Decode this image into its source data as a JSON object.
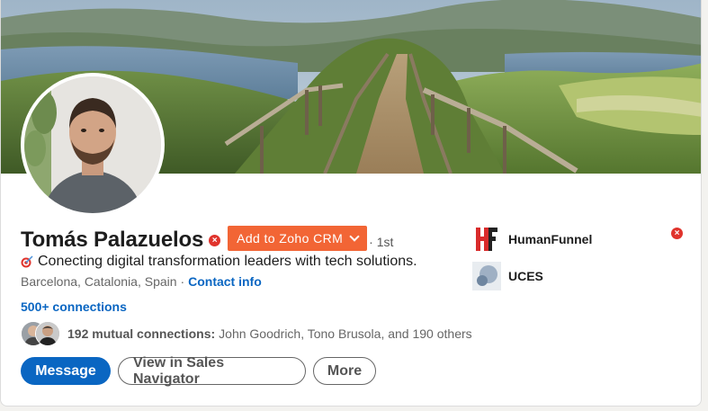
{
  "profile": {
    "name": "Tomás Palazuelos",
    "degree": "· 1st",
    "headline": "Conecting digital transformation leaders with tech solutions.",
    "location": "Barcelona, Catalonia, Spain ·",
    "contact_info": "Contact info",
    "connections": "500+ connections"
  },
  "zoho": {
    "button_label": "Add to Zoho CRM",
    "color": "#f26535"
  },
  "mutual": {
    "count_label": "192 mutual connections:",
    "names": "John Goodrich, Tono Brusola, and 190 others"
  },
  "actions": {
    "message": "Message",
    "sales_navigator": "View in Sales Navigator",
    "more": "More"
  },
  "organizations": [
    {
      "name": "HumanFunnel",
      "icon": "humanfunnel-logo"
    },
    {
      "name": "UCES",
      "icon": "uces-logo"
    }
  ],
  "colors": {
    "accent": "#0a66c2",
    "remove_badge": "#e0332c"
  }
}
